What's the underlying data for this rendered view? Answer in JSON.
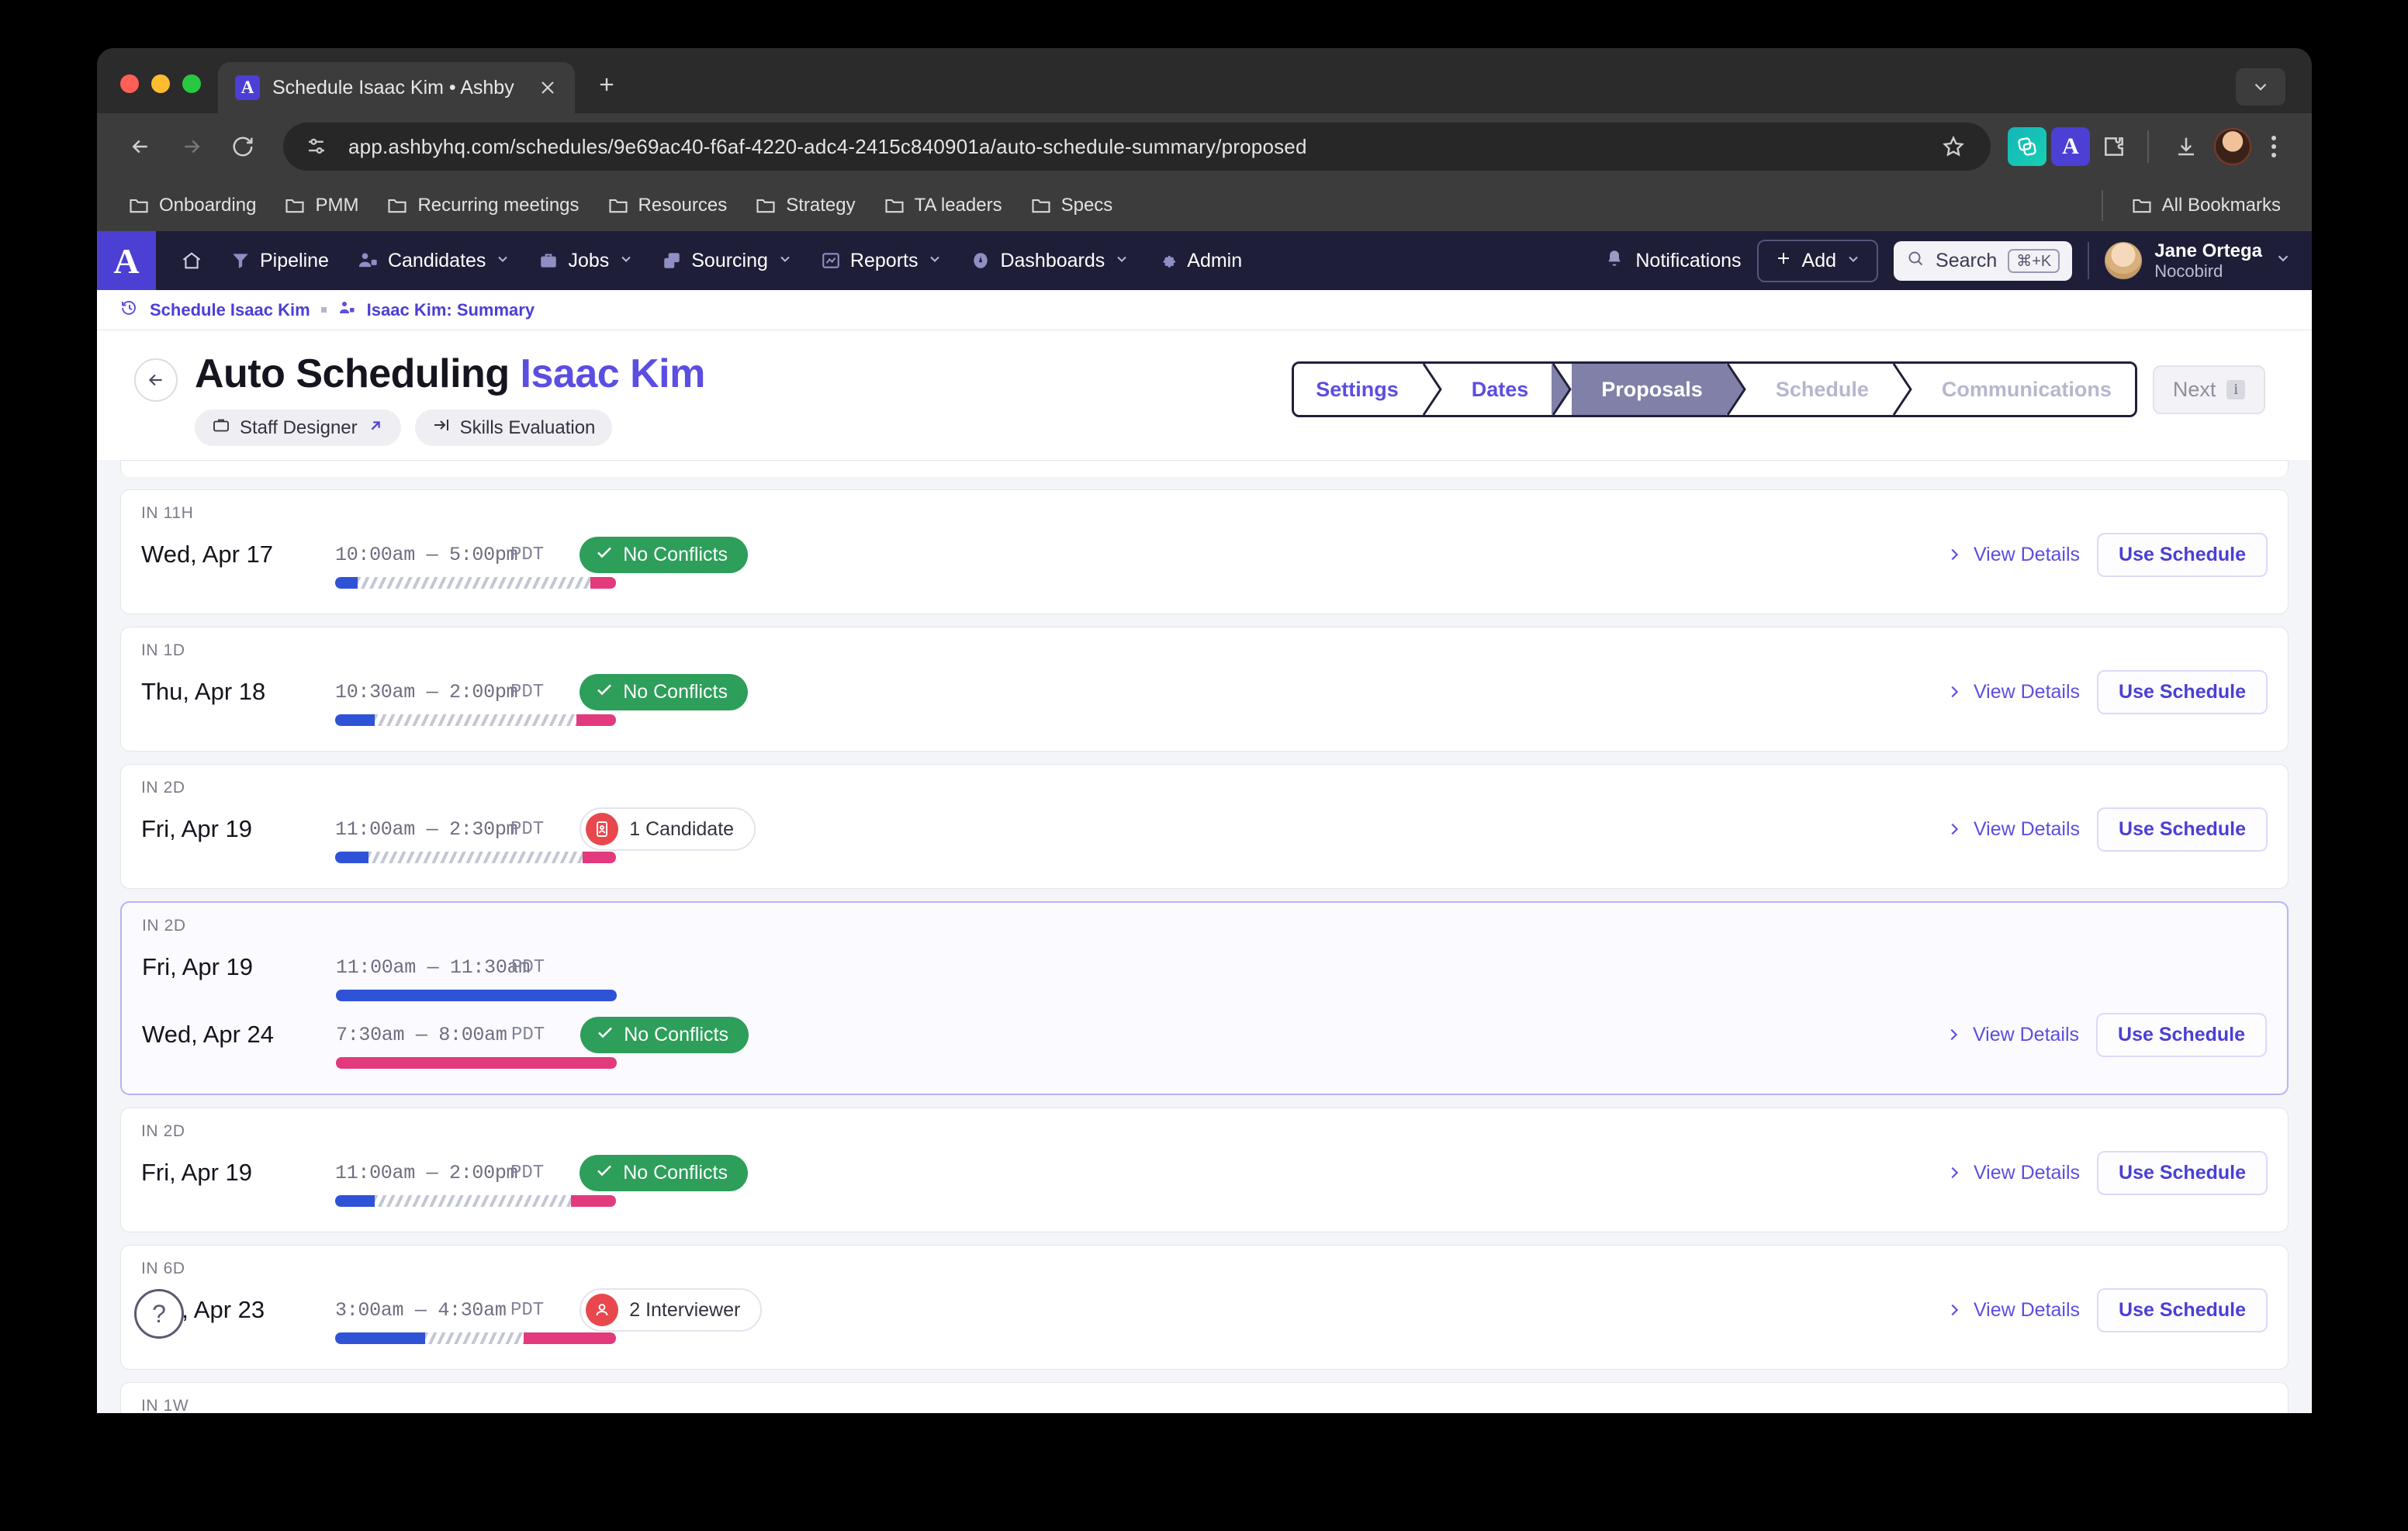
{
  "browser": {
    "tab": {
      "title": "Schedule Isaac Kim • Ashby",
      "favicon": "ashby-logo-icon"
    },
    "url": "app.ashbyhq.com/schedules/9e69ac40-f6af-4220-adc4-2415c840901a/auto-schedule-summary/proposed",
    "bookmarks": [
      "Onboarding",
      "PMM",
      "Recurring meetings",
      "Resources",
      "Strategy",
      "TA leaders",
      "Specs"
    ],
    "all_bookmarks": "All Bookmarks"
  },
  "appnav": {
    "logo": "A",
    "items": [
      {
        "label": "Pipeline",
        "icon": "funnel-icon",
        "caret": false
      },
      {
        "label": "Candidates",
        "icon": "people-icon",
        "caret": true
      },
      {
        "label": "Jobs",
        "icon": "briefcase-icon",
        "caret": true
      },
      {
        "label": "Sourcing",
        "icon": "stack-icon",
        "caret": true
      },
      {
        "label": "Reports",
        "icon": "chart-icon",
        "caret": true
      },
      {
        "label": "Dashboards",
        "icon": "gauge-icon",
        "caret": true
      },
      {
        "label": "Admin",
        "icon": "gear-icon",
        "caret": false
      }
    ],
    "notifications": "Notifications",
    "add": "Add",
    "search": "Search",
    "search_shortcut": "⌘+K",
    "user_name": "Jane Ortega",
    "user_org": "Nocobird"
  },
  "breadcrumb": {
    "first": "Schedule Isaac Kim",
    "second": "Isaac Kim: Summary"
  },
  "page": {
    "title_prefix": "Auto Scheduling",
    "title_name": "Isaac Kim",
    "pill_job": "Staff Designer",
    "pill_stage": "Skills Evaluation",
    "next_label": "Next",
    "next_badge": "i",
    "steps": [
      {
        "label": "Settings",
        "state": "done"
      },
      {
        "label": "Dates",
        "state": "done"
      },
      {
        "label": "Proposals",
        "state": "active"
      },
      {
        "label": "Schedule",
        "state": "muted"
      },
      {
        "label": "Communications",
        "state": "muted"
      }
    ]
  },
  "labels": {
    "view_details": "View Details",
    "use_schedule": "Use Schedule",
    "timezone": "PDT",
    "help": "?"
  },
  "colors": {
    "accent": "#4b3fd4",
    "active_step": "#8080a8",
    "success": "#2e9e5b",
    "conflict": "#e8484d",
    "bar_start": "#2f53d7",
    "bar_end": "#e23a7c"
  },
  "proposals": [
    {
      "tag": "IN 11H",
      "slots": [
        {
          "date": "Wed, Apr 17",
          "time": "10:00am — 5:00pm",
          "tz": "PDT",
          "bar": {
            "style": "split",
            "blue_pct": 8,
            "pink_pct": 9
          }
        }
      ],
      "status": {
        "type": "ok",
        "text": "No Conflicts"
      },
      "selected": false
    },
    {
      "tag": "IN 1D",
      "slots": [
        {
          "date": "Thu, Apr 18",
          "time": "10:30am — 2:00pm",
          "tz": "PDT",
          "bar": {
            "style": "split",
            "blue_pct": 14,
            "pink_pct": 14
          }
        }
      ],
      "status": {
        "type": "ok",
        "text": "No Conflicts"
      },
      "selected": false
    },
    {
      "tag": "IN 2D",
      "slots": [
        {
          "date": "Fri, Apr 19",
          "time": "11:00am — 2:30pm",
          "tz": "PDT",
          "bar": {
            "style": "split",
            "blue_pct": 12,
            "pink_pct": 12
          }
        }
      ],
      "status": {
        "type": "conflict",
        "text": "1 Candidate",
        "icon": "candidate-badge-icon"
      },
      "selected": false
    },
    {
      "tag": "IN 2D",
      "slots": [
        {
          "date": "Fri, Apr 19",
          "time": "11:00am — 11:30am",
          "tz": "PDT",
          "bar": {
            "style": "solid-blue"
          }
        },
        {
          "date": "Wed, Apr 24",
          "time": "7:30am — 8:00am",
          "tz": "PDT",
          "bar": {
            "style": "solid-pink"
          }
        }
      ],
      "status": {
        "type": "ok",
        "text": "No Conflicts"
      },
      "selected": true
    },
    {
      "tag": "IN 2D",
      "slots": [
        {
          "date": "Fri, Apr 19",
          "time": "11:00am — 2:00pm",
          "tz": "PDT",
          "bar": {
            "style": "split",
            "blue_pct": 14,
            "pink_pct": 16
          }
        }
      ],
      "status": {
        "type": "ok",
        "text": "No Conflicts"
      },
      "selected": false
    },
    {
      "tag": "IN 6D",
      "slots": [
        {
          "date": "Tue, Apr 23",
          "time": "3:00am — 4:30am",
          "tz": "PDT",
          "bar": {
            "style": "split",
            "blue_pct": 32,
            "pink_pct": 33
          }
        }
      ],
      "status": {
        "type": "conflict",
        "text": "2 Interviewer",
        "icon": "interviewer-badge-icon"
      },
      "selected": false
    },
    {
      "tag": "IN 1W",
      "slots": [],
      "status": null,
      "selected": false,
      "partial": true
    }
  ]
}
